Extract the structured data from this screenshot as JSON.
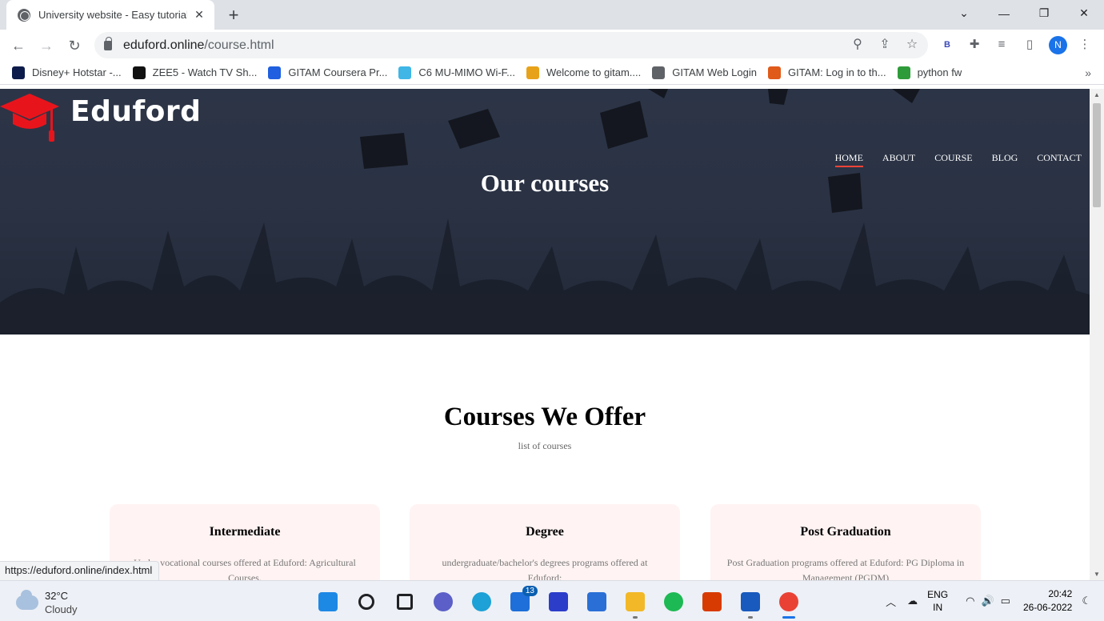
{
  "browser": {
    "tab_title": "University website - Easy tutorial",
    "url_host": "eduford.online",
    "url_path": "/course.html",
    "profile_initial": "N",
    "extension_letter": "B",
    "status_url": "https://eduford.online/index.html"
  },
  "bookmarks": [
    {
      "label": "Disney+ Hotstar -...",
      "color": "#0c1b4a"
    },
    {
      "label": "ZEE5 - Watch TV Sh...",
      "color": "#111111"
    },
    {
      "label": "GITAM Coursera Pr...",
      "color": "#1f5fe0"
    },
    {
      "label": "C6 MU-MIMO Wi-F...",
      "color": "#3fb6e6"
    },
    {
      "label": "Welcome to gitam....",
      "color": "#e8a21a"
    },
    {
      "label": "GITAM Web Login",
      "color": "#5f6368"
    },
    {
      "label": "GITAM: Log in to th...",
      "color": "#e05a1a"
    },
    {
      "label": "python fw",
      "color": "#2e9b3a"
    }
  ],
  "site": {
    "brand": "Eduford",
    "nav": [
      "HOME",
      "ABOUT",
      "COURSE",
      "BLOG",
      "CONTACT"
    ],
    "hero_title": "Our courses",
    "section_title": "Courses We Offer",
    "section_subtitle": "list of courses",
    "cards": [
      {
        "title": "Intermediate",
        "text": "Under vocational courses offered at Eduford: Agricultural Courses."
      },
      {
        "title": "Degree",
        "text": "undergraduate/bachelor's degrees programs offered at Eduford:"
      },
      {
        "title": "Post Graduation",
        "text": "Post Graduation programs offered at Eduford: PG Diploma in Management (PGDM)"
      }
    ],
    "accent_color": "#f44336"
  },
  "taskbar": {
    "temperature": "32°C",
    "weather": "Cloudy",
    "mail_badge": "13",
    "lang_line1": "ENG",
    "lang_line2": "IN",
    "time": "20:42",
    "date": "26-06-2022",
    "apps": [
      {
        "name": "windows-start-icon",
        "color": "#1e88e5"
      },
      {
        "name": "search-icon",
        "color": "#202124"
      },
      {
        "name": "task-view-icon",
        "color": "#202124"
      },
      {
        "name": "teams-chat-icon",
        "color": "#5b5fc7"
      },
      {
        "name": "edge-icon",
        "color": "#1da1d6"
      },
      {
        "name": "mail-icon",
        "color": "#1e6fd9"
      },
      {
        "name": "photo-editor-icon",
        "color": "#2b3dc9"
      },
      {
        "name": "store-icon",
        "color": "#2a6fd6"
      },
      {
        "name": "file-explorer-icon",
        "color": "#f2b827"
      },
      {
        "name": "spotify-icon",
        "color": "#1db954"
      },
      {
        "name": "office-icon",
        "color": "#d83b01"
      },
      {
        "name": "word-icon",
        "color": "#185abd"
      },
      {
        "name": "chrome-icon",
        "color": "#e94235"
      }
    ]
  }
}
